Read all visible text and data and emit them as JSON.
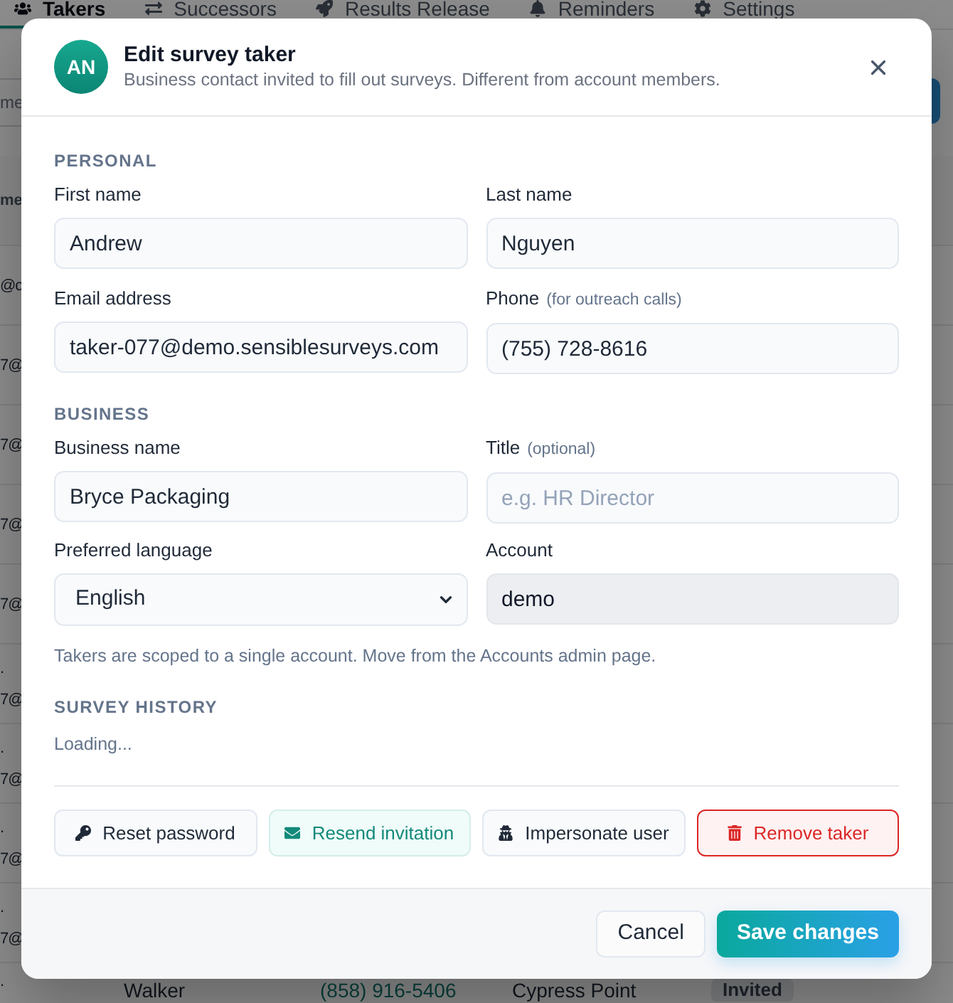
{
  "background": {
    "tabs": [
      {
        "label": "Takers",
        "selected": true
      },
      {
        "label": "Successors",
        "selected": false
      },
      {
        "label": "Results Release",
        "selected": false
      },
      {
        "label": "Reminders",
        "selected": false
      },
      {
        "label": "Settings",
        "selected": false
      }
    ],
    "search": {
      "placeholder": "me"
    },
    "table": {
      "column_1": "me",
      "rows": [
        {
          "lines": [
            "@c"
          ]
        },
        {
          "lines": [
            "7@"
          ]
        },
        {
          "lines": [
            "7@"
          ]
        },
        {
          "lines": [
            "7@"
          ]
        },
        {
          "lines": [
            "7@"
          ]
        },
        {
          "lines": [
            ".",
            "7@"
          ]
        },
        {
          "lines": [
            ".",
            "7@"
          ]
        },
        {
          "lines": [
            ".",
            "7@"
          ]
        },
        {
          "lines": [
            ".",
            "7@"
          ]
        },
        {
          "lines": [
            "."
          ],
          "cells": [
            "Walker",
            "(858) 916-5406",
            "Cypress Point"
          ],
          "status": "Invited"
        }
      ]
    }
  },
  "dialog": {
    "avatar": "AN",
    "title": "Edit survey taker",
    "subtitle": "Business contact invited to fill out surveys. Different from account members.",
    "sections": [
      {
        "heading": "PERSONAL",
        "fields": [
          {
            "label": "First name",
            "kind": "text",
            "value": "Andrew",
            "disabled": false
          },
          {
            "label": "Last name",
            "kind": "text",
            "value": "Nguyen",
            "disabled": false
          },
          {
            "label": "Email address",
            "kind": "text",
            "value": "taker-077@demo.sensiblesurveys.com",
            "disabled": false
          },
          {
            "label": "Phone",
            "hint": "(for outreach calls)",
            "kind": "text",
            "value": "(755) 728-8616",
            "disabled": false
          }
        ]
      },
      {
        "heading": "BUSINESS",
        "fields": [
          {
            "label": "Business name",
            "kind": "text",
            "value": "Bryce Packaging",
            "disabled": false
          },
          {
            "label": "Title",
            "hint": "(optional)",
            "kind": "text",
            "placeholder": "e.g. HR Director",
            "disabled": false
          },
          {
            "label": "Preferred language",
            "kind": "select",
            "value": "English",
            "disabled": false
          },
          {
            "label": "Account",
            "kind": "text",
            "value": "demo",
            "disabled": true
          }
        ],
        "note": "Takers are scoped to a single account. Move from the Accounts admin page."
      },
      {
        "heading": "SURVEY HISTORY",
        "status": "Loading..."
      }
    ],
    "actions": [
      {
        "kind": "reset_password",
        "label": "Reset password"
      },
      {
        "kind": "resend",
        "label": "Resend invitation"
      },
      {
        "kind": "impersonate",
        "label": "Impersonate user"
      },
      {
        "kind": "remove",
        "label": "Remove taker"
      }
    ],
    "footer": [
      {
        "kind": "secondary",
        "label": "Cancel"
      },
      {
        "kind": "primary",
        "label": "Save changes"
      }
    ]
  }
}
